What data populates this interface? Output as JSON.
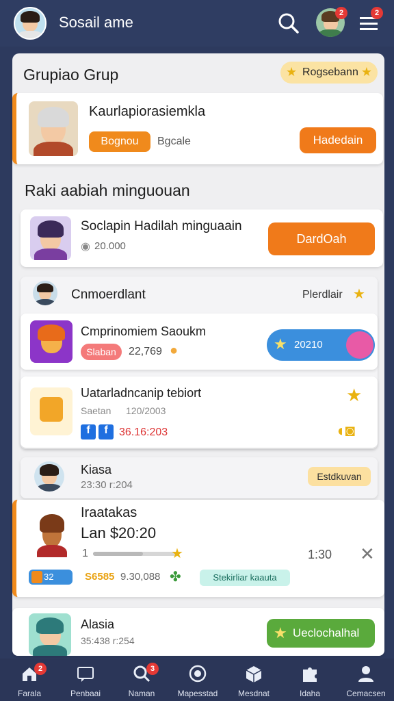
{
  "header": {
    "title": "Sosail ame",
    "notif_count": "2",
    "menu_count": "2"
  },
  "group": {
    "title": "Grupiao Grup",
    "badge": "Rogsebann",
    "member_name": "Kaurlapiorasiemkla",
    "tag": "Bognou",
    "sub": "Bgcale",
    "action": "Hadedain"
  },
  "reward": {
    "title": "Raki aabiah minguouan",
    "name": "Soclapin Hadilah minguaain",
    "amount": "20.000",
    "action": "DardOah"
  },
  "feed": {
    "header_name": "Cnmoerdlant",
    "header_link": "Plerdlair",
    "item1_title": "Cmprinomiem Saoukm",
    "item1_tag": "Slaban",
    "item1_value": "22,769",
    "item1_score": "20210",
    "item2_title": "Uatarladncanip tebiort",
    "item2_sub": "Saetan",
    "item2_time": "120/2003",
    "item2_value": "36.16:203"
  },
  "kiasa": {
    "name": "Kiasa",
    "time": "23:30 r:204",
    "badge": "Estdkuvan"
  },
  "iraatakas": {
    "name": "Iraatakas",
    "line2": "Lan $20:20",
    "progress_start": "1",
    "progress_fraction": 0.6,
    "progress_end": "1:30",
    "chip": "32",
    "stat_a": "S6585",
    "stat_b": "9.30,088",
    "status": "Stekirliar kaauta"
  },
  "alasia": {
    "name": "Alasia",
    "time": "35:438 r:254",
    "action": "Ueclochalhal"
  },
  "nav": [
    {
      "label": "Farala",
      "icon": "home-icon",
      "badge": "2"
    },
    {
      "label": "Penbaai",
      "icon": "chat-icon",
      "badge": ""
    },
    {
      "label": "Naman",
      "icon": "search-icon",
      "badge": "3"
    },
    {
      "label": "Mapesstad",
      "icon": "target-icon",
      "badge": ""
    },
    {
      "label": "Mesdnat",
      "icon": "box-icon",
      "badge": ""
    },
    {
      "label": "Idaha",
      "icon": "puzzle-icon",
      "badge": ""
    },
    {
      "label": "Cemacsen",
      "icon": "user-icon",
      "badge": ""
    }
  ],
  "colors": {
    "header_bg": "#2f3d62",
    "accent_orange": "#f08a1c",
    "accent_blue": "#3b8fdd",
    "accent_green": "#5aaa3c",
    "badge_red": "#e53935"
  }
}
